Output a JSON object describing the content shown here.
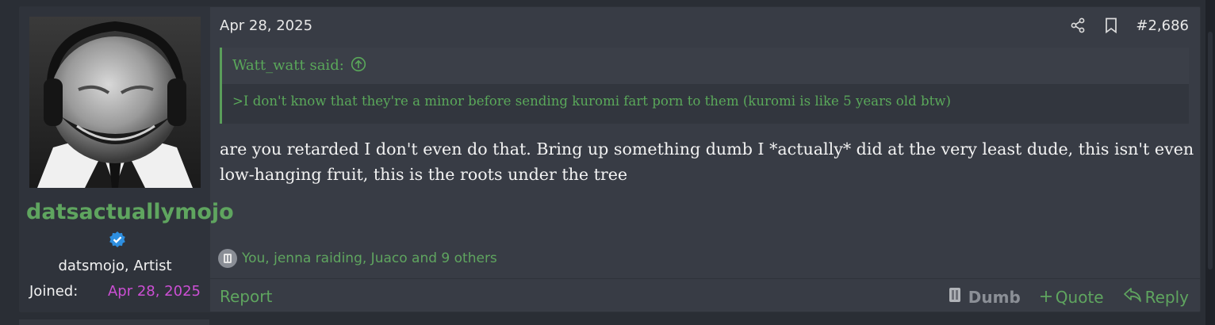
{
  "post": {
    "author": {
      "username": "datsactuallymojo",
      "verified_icon": "verified-check-icon",
      "user_title": "datsmojo, Artist",
      "joined_label": "Joined:",
      "joined_date": "Apr 28, 2025"
    },
    "date": "Apr 28, 2025",
    "number": "#2,686",
    "header_icons": [
      "share-icon",
      "bookmark-icon"
    ],
    "quote": {
      "attribution": "Watt_watt said:",
      "text": ">I don't know that they're a minor before sending kuromi fart porn to them (kuromi is like 5 years old btw)"
    },
    "body": "are you retarded I don't even do that. Bring up something dumb I *actually* did at the very least dude, this isn't even low-hanging fruit, this is the roots under the tree",
    "reactions_text": "You, jenna raiding, Juaco and 9 others",
    "footer": {
      "report": "Report",
      "dumb": "Dumb",
      "quote": "Quote",
      "reply": "Reply"
    }
  },
  "colors": {
    "accent_green": "#5fa55f",
    "date_magenta": "#cc4fd4",
    "post_bg": "#383c45",
    "sidebar_bg": "#2f333b"
  }
}
